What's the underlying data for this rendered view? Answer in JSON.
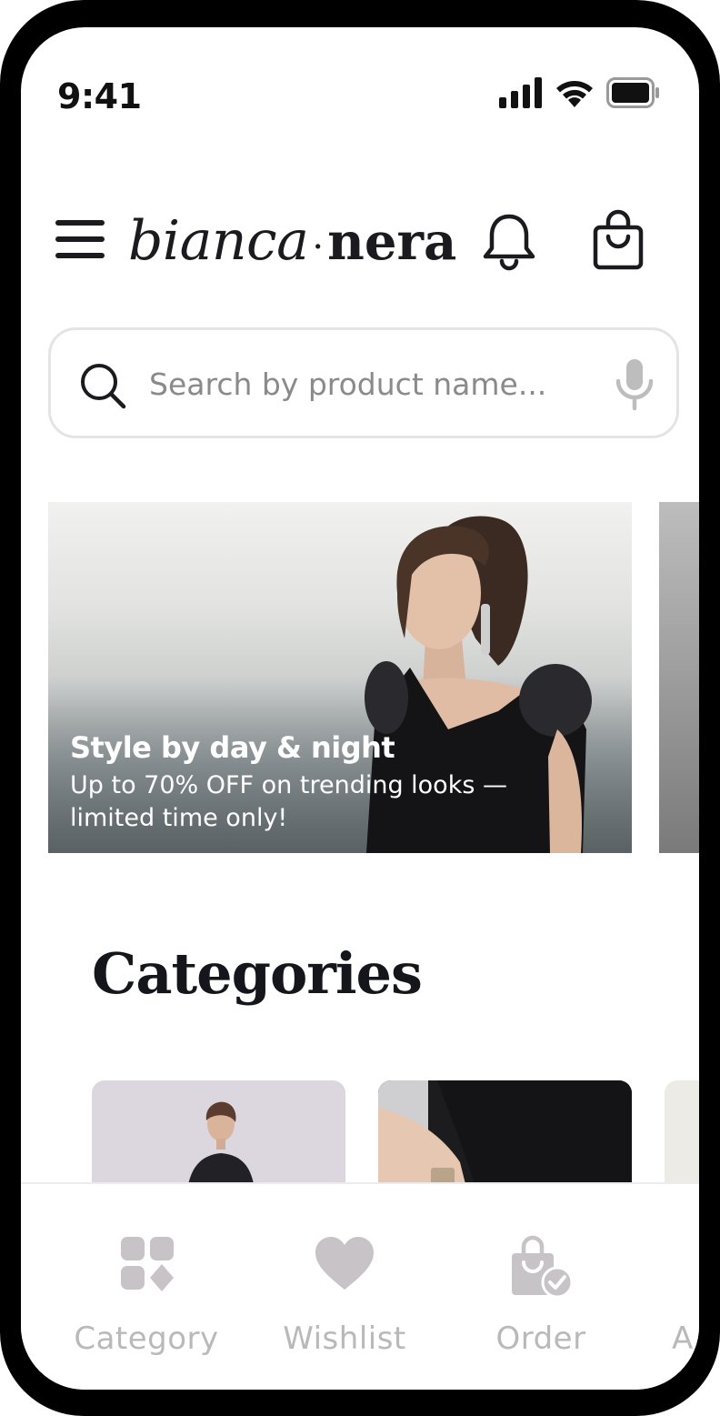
{
  "status_bar": {
    "time": "9:41"
  },
  "header": {
    "logo_part1": "bianca",
    "logo_separator": "·",
    "logo_part2": "nera"
  },
  "search": {
    "placeholder": "Search by product name..."
  },
  "banner": {
    "title": "Style by day & night",
    "subtitle_line1": "Up to 70% OFF on trending looks —",
    "subtitle_line2": "limited time only!"
  },
  "categories": {
    "title": "Categories"
  },
  "bottom_nav": {
    "items": [
      {
        "label": "Category",
        "icon": "category-icon"
      },
      {
        "label": "Wishlist",
        "icon": "heart-icon"
      },
      {
        "label": "Order",
        "icon": "order-bag-icon"
      },
      {
        "label": "A",
        "icon": "account-icon"
      }
    ]
  },
  "colors": {
    "text_primary": "#1a1a1f",
    "nav_inactive": "#b9b9bb",
    "nav_icon": "#c8c3c6",
    "border": "#e4e4e4"
  }
}
